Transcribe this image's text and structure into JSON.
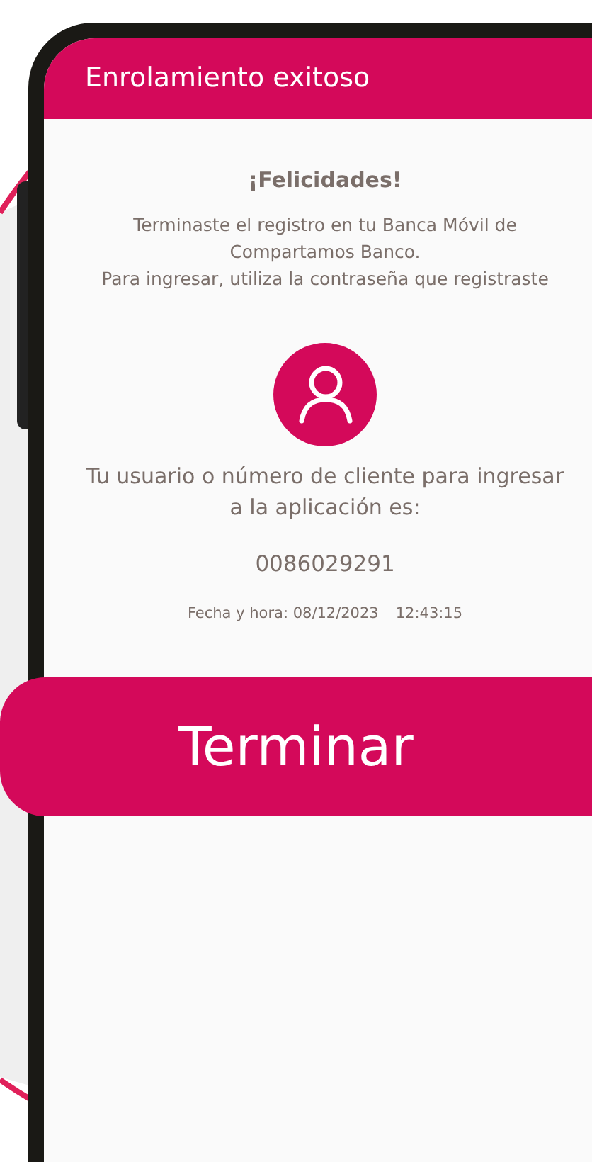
{
  "header": {
    "title": "Enrolamiento exitoso"
  },
  "message": {
    "heading": "¡Felicidades!",
    "lines": [
      "Terminaste el registro en tu Banca Móvil de",
      "Compartamos Banco.",
      "Para ingresar, utiliza la contraseña que registraste"
    ]
  },
  "user_info": {
    "label_lines": [
      "Tu usuario o número de cliente para ingresar",
      "a la aplicación es:"
    ],
    "client_number": "0086029291",
    "date_label": "Fecha y hora: 08/12/2023",
    "time": "12:43:15"
  },
  "button": {
    "label": "Terminar"
  }
}
